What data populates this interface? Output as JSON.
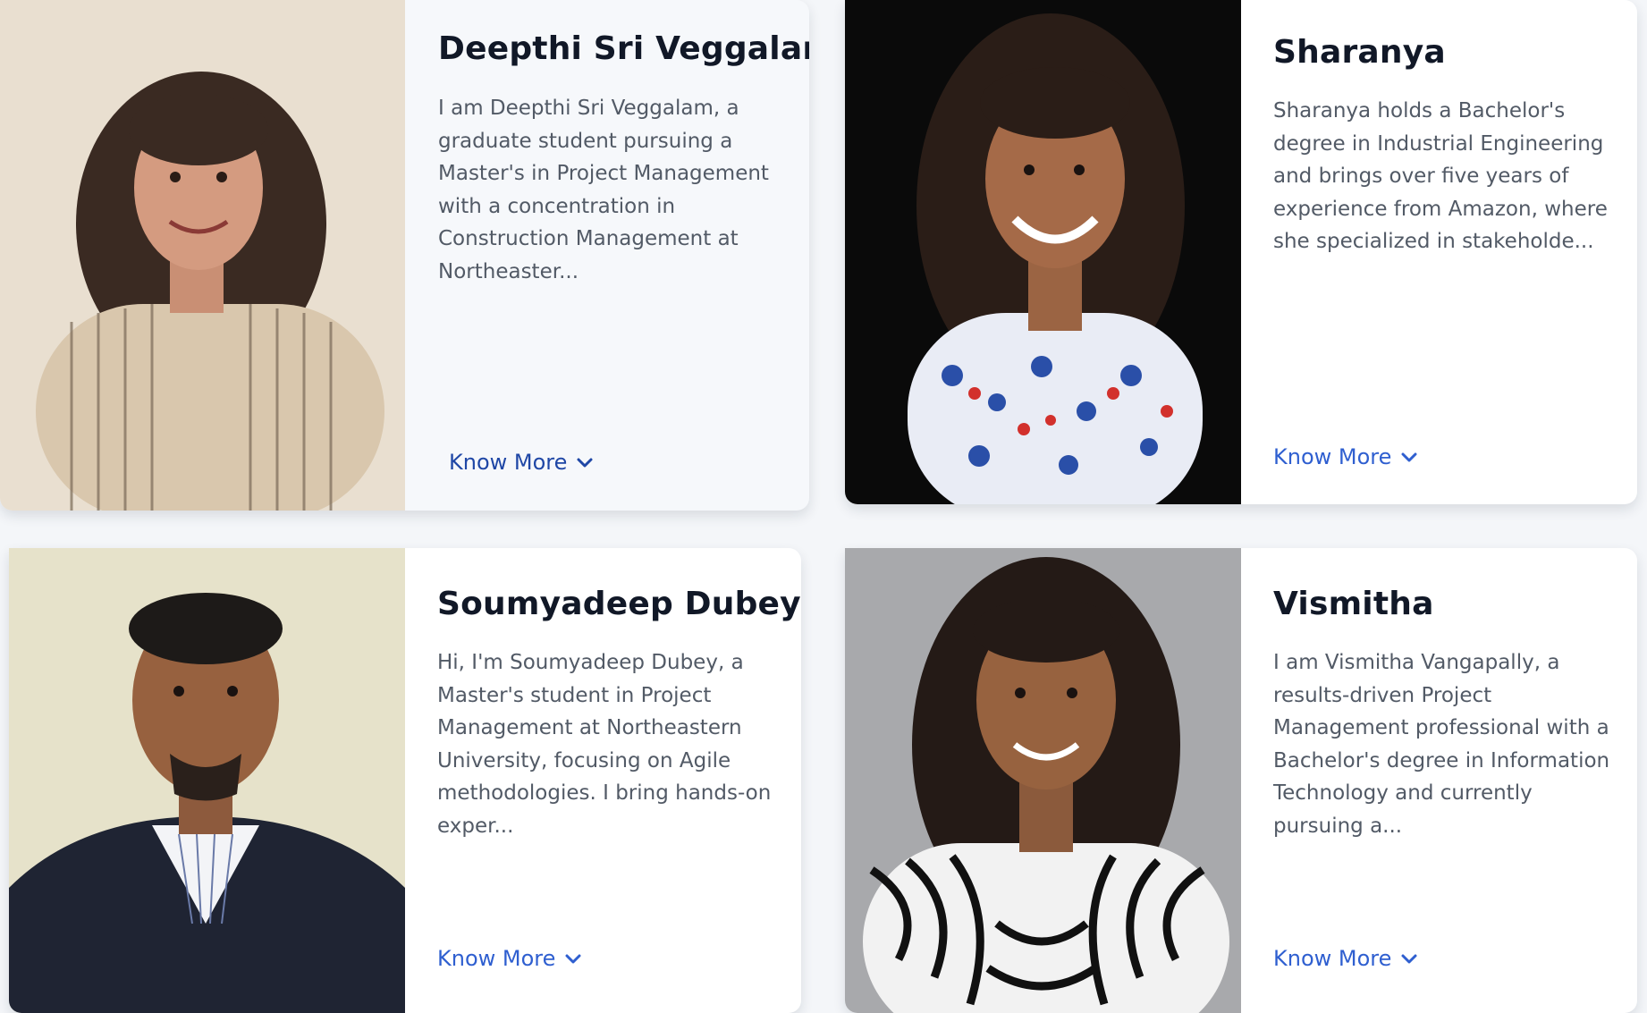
{
  "members": [
    {
      "name": "Deepthi Sri Veggalam",
      "description": "I am Deepthi Sri Veggalam, a graduate student pursuing a Master's in Project Management with a concentration in Construction Management at Northeaster...",
      "cta": "Know More",
      "photo_icon": "portrait-photo"
    },
    {
      "name": "Sharanya",
      "description": "Sharanya holds a Bachelor's degree in Industrial Engineering and brings over five years of experience from Amazon, where she specialized in stakeholde...",
      "cta": "Know More",
      "photo_icon": "portrait-photo"
    },
    {
      "name": "Soumyadeep Dubey",
      "description": "Hi, I'm Soumyadeep Dubey, a Master's student in Project Management at Northeastern University, focusing on Agile methodologies. I bring hands-on exper...",
      "cta": "Know More",
      "photo_icon": "portrait-photo"
    },
    {
      "name": "Vismitha",
      "description": "I am Vismitha Vangapally, a results-driven Project Management professional with a Bachelor's degree in Information Technology and currently pursuing a...",
      "cta": "Know More",
      "photo_icon": "portrait-photo"
    }
  ],
  "colors": {
    "accent": "#2f5fd0",
    "accent_hover": "#1f47a6",
    "heading": "#111827",
    "body_text": "#525a66",
    "page_bg": "#f4f6f9"
  }
}
